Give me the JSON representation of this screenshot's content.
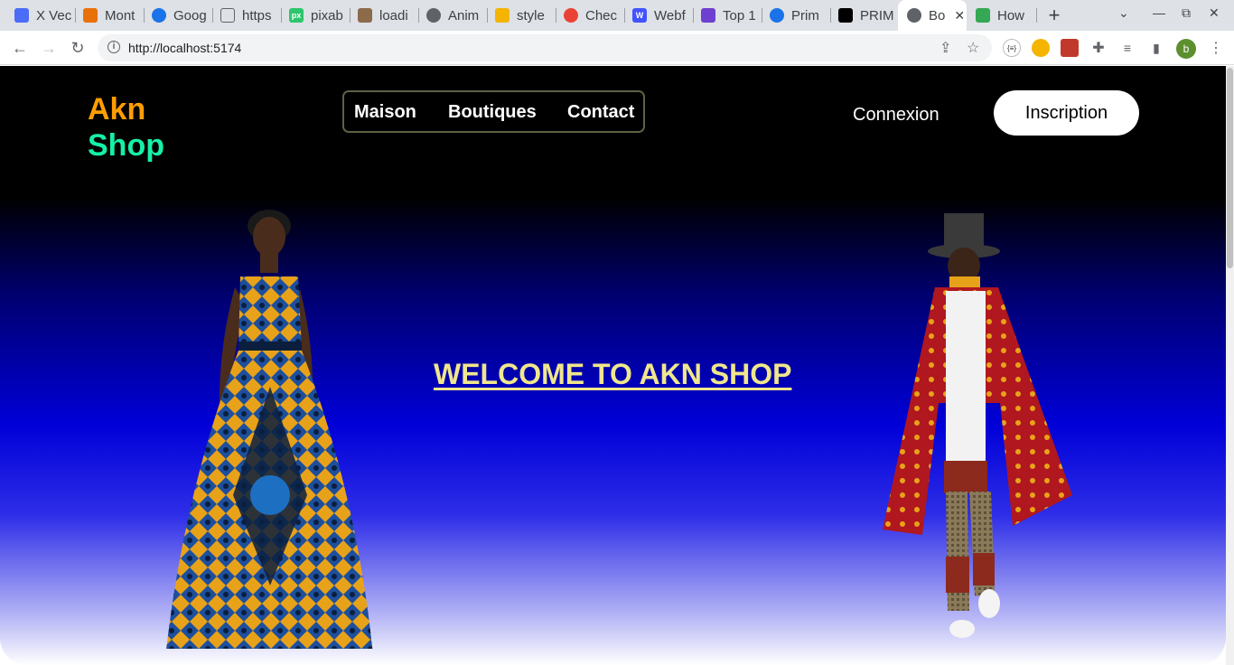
{
  "browser": {
    "tabs": [
      {
        "label": "X Vec",
        "color": "#4a6cf7"
      },
      {
        "label": "Mont",
        "color": "#e8710a"
      },
      {
        "label": "Goog",
        "color": "#1a73e8"
      },
      {
        "label": "https",
        "color": "#5f6368"
      },
      {
        "label": "pixab",
        "color": "#2ec66d"
      },
      {
        "label": "loadi",
        "color": "#8b6b4a"
      },
      {
        "label": "Anim",
        "color": "#5f6368"
      },
      {
        "label": "style",
        "color": "#f4b400"
      },
      {
        "label": "Chec",
        "color": "#ea4335"
      },
      {
        "label": "Webf",
        "color": "#4353ff"
      },
      {
        "label": "Top 1",
        "color": "#6e3fd1"
      },
      {
        "label": "Prim",
        "color": "#1a73e8"
      },
      {
        "label": "PRIM",
        "color": "#000000"
      },
      {
        "label": "Bo",
        "color": "#5f6368"
      },
      {
        "label": "How",
        "color": "#34a853"
      }
    ],
    "url": "http://localhost:5174",
    "profile_initial": "b"
  },
  "site": {
    "logo_line1": "Akn",
    "logo_line2": "Shop",
    "nav": [
      "Maison",
      "Boutiques",
      "Contact"
    ],
    "login_label": "Connexion",
    "signup_label": "Inscription",
    "hero_title": "WELCOME TO AKN SHOP"
  },
  "colors": {
    "logo_orange": "#ff9d00",
    "logo_green": "#16f0a8",
    "hero_title": "#f0e68c",
    "nav_border": "#5d6244"
  }
}
